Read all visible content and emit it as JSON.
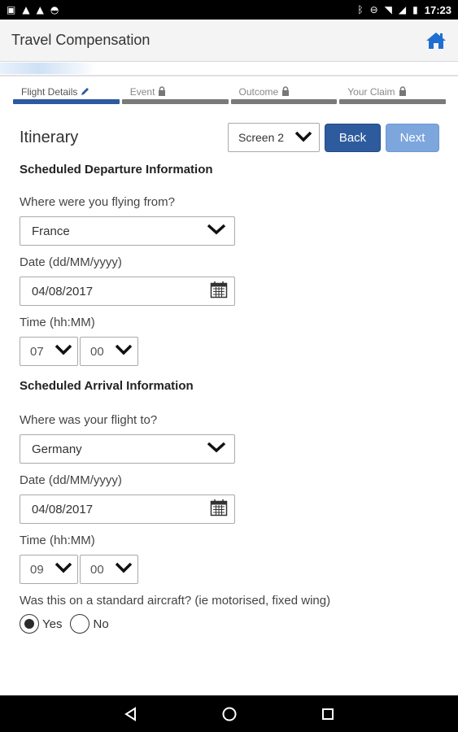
{
  "status_bar": {
    "left_icons": [
      "image-icon",
      "warning-icon",
      "warning-icon",
      "android-icon"
    ],
    "right_icons": [
      "bluetooth-icon",
      "do-not-disturb-icon",
      "wifi-icon",
      "signal-icon",
      "battery-icon"
    ],
    "time": "17:23"
  },
  "header": {
    "title": "Travel Compensation",
    "home_icon": "home-icon",
    "accent": "#1f6fd1"
  },
  "steps": [
    {
      "label": "Flight Details",
      "icon": "pencil-icon",
      "active": true
    },
    {
      "label": "Event",
      "icon": "lock-icon",
      "active": false
    },
    {
      "label": "Outcome",
      "icon": "lock-icon",
      "active": false
    },
    {
      "label": "Your Claim",
      "icon": "lock-icon",
      "active": false
    }
  ],
  "section": {
    "title": "Itinerary",
    "screen_select": "Screen 2",
    "back_label": "Back",
    "next_label": "Next"
  },
  "departure": {
    "heading": "Scheduled Departure Information",
    "from_label": "Where were you flying from?",
    "from_value": "France",
    "date_label": "Date (dd/MM/yyyy)",
    "date_value": "04/08/2017",
    "time_label": "Time (hh:MM)",
    "hour": "07",
    "minute": "00"
  },
  "arrival": {
    "heading": "Scheduled Arrival Information",
    "to_label": "Where was your flight to?",
    "to_value": "Germany",
    "date_label": "Date (dd/MM/yyyy)",
    "date_value": "04/08/2017",
    "time_label": "Time (hh:MM)",
    "hour": "09",
    "minute": "00"
  },
  "aircraft": {
    "question": "Was this on a standard aircraft? (ie motorised, fixed wing)",
    "yes_label": "Yes",
    "no_label": "No",
    "selected": "Yes"
  },
  "colors": {
    "step_active": "#2c5aa0",
    "step_inactive": "#7a7a7a",
    "back_button": "#2e5b9e",
    "next_button": "#7da6dd"
  }
}
